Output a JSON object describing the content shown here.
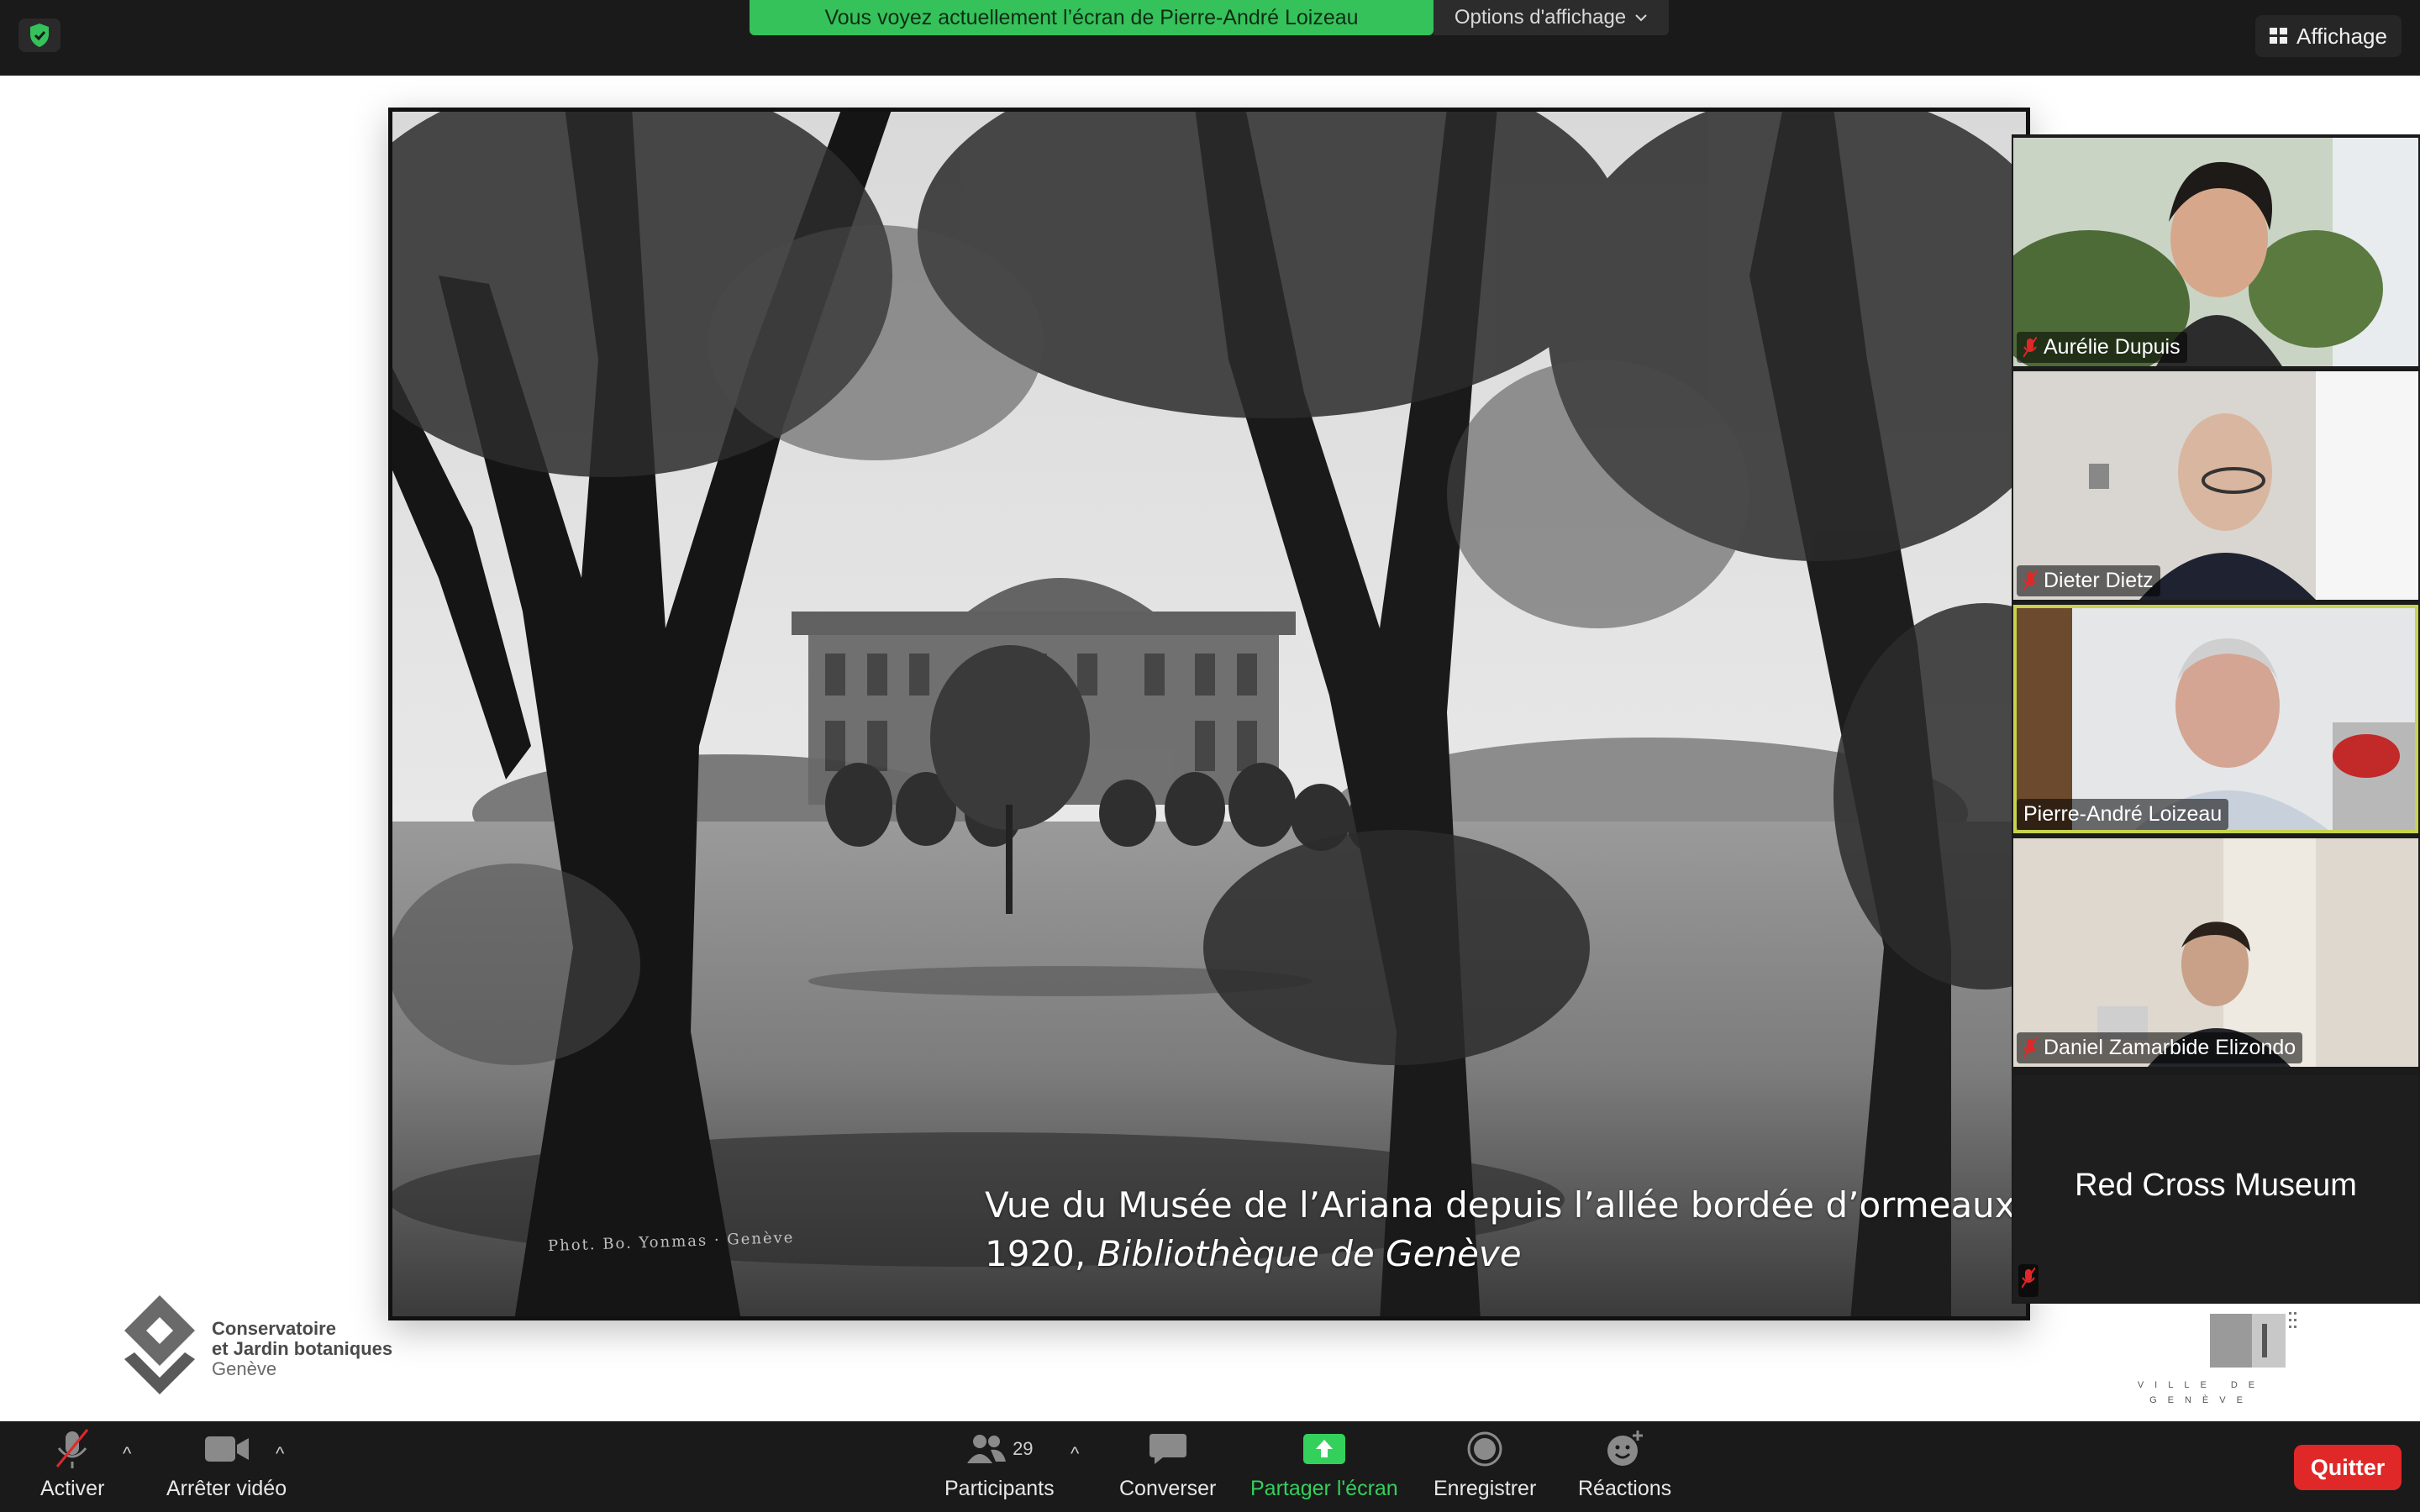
{
  "topbar": {
    "banner_text": "Vous voyez actuellement l’écran de Pierre-André Loizeau",
    "view_options_label": "Options d'affichage",
    "view_label": "Affichage"
  },
  "slide": {
    "caption_line1": "Vue du Musée de l’Ariana depuis l’allée bordée d’ormeaux",
    "caption_year": "1920, ",
    "caption_source": "Bibliothèque de Genève",
    "photo_credit": "Phot. Bo. Yonmas · Genève",
    "logo_left": {
      "line1": "Conservatoire",
      "line2": "et Jardin botaniques",
      "line3": "Genève"
    },
    "logo_right": {
      "line1": "VILLE DE",
      "line2": "GENÈVE"
    }
  },
  "participants": [
    {
      "name": "Aurélie Dupuis",
      "muted": true,
      "active": false
    },
    {
      "name": "Dieter Dietz",
      "muted": true,
      "active": false
    },
    {
      "name": "Pierre-André Loizeau",
      "muted": false,
      "active": true
    },
    {
      "name": "Daniel Zamarbide Elizondo",
      "muted": true,
      "active": false
    }
  ],
  "name_tile": {
    "name": "Red Cross Museum",
    "muted": true
  },
  "toolbar": {
    "unmute_label": "Activer",
    "stop_video_label": "Arrêter vidéo",
    "participants_label": "Participants",
    "participants_count": "29",
    "chat_label": "Converser",
    "share_label": "Partager l'écran",
    "record_label": "Enregistrer",
    "reactions_label": "Réactions",
    "quit_label": "Quitter"
  },
  "colors": {
    "banner": "#35c25b",
    "active_speaker": "#c7d34e",
    "quit": "#e02828",
    "share_green": "#34d05c"
  }
}
